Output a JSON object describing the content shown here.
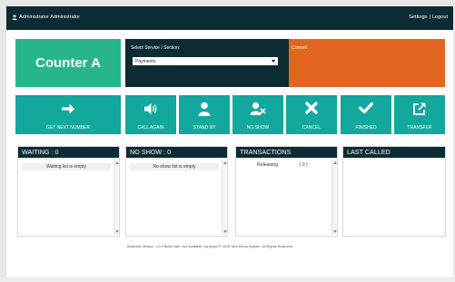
{
  "topbar": {
    "user": "Administrator Administrator",
    "settings": "Settings",
    "separator": "|",
    "logout": "Logout"
  },
  "counter": {
    "label": "Counter A"
  },
  "service": {
    "label": "Select Service / Section:",
    "selected": "Payments"
  },
  "current": {
    "label": "Current"
  },
  "buttons": [
    {
      "label": "GET NEXT NUMBER",
      "icon": "arrow-right-icon"
    },
    {
      "label": "CALL AGAIN",
      "icon": "volume-icon"
    },
    {
      "label": "STAND BY",
      "icon": "user-icon"
    },
    {
      "label": "NO SHOW",
      "icon": "user-x-icon"
    },
    {
      "label": "CANCEL",
      "icon": "close-icon"
    },
    {
      "label": "FINISHED",
      "icon": "check-icon"
    },
    {
      "label": "TRANSFER",
      "icon": "external-link-icon"
    }
  ],
  "lists": {
    "waiting": {
      "title": "WAITING : 0",
      "empty": "Waiting list is empty"
    },
    "noshow": {
      "title": "NO SHOW : 0",
      "empty": "No show list is empty"
    },
    "transactions": {
      "title": "TRANSACTIONS",
      "item": "Releasing",
      "count": "( 0 )"
    },
    "lastcalled": {
      "title": "LAST CALLED"
    }
  },
  "footer": {
    "text": "Business Version: 1.0.0   Build Date: Not Available   Copyright © 2015 Vant Demo System. All Rights Reserved."
  },
  "colors": {
    "dark": "#0d2b33",
    "green": "#27b68c",
    "teal": "#13a89e",
    "orange": "#e3661f"
  }
}
